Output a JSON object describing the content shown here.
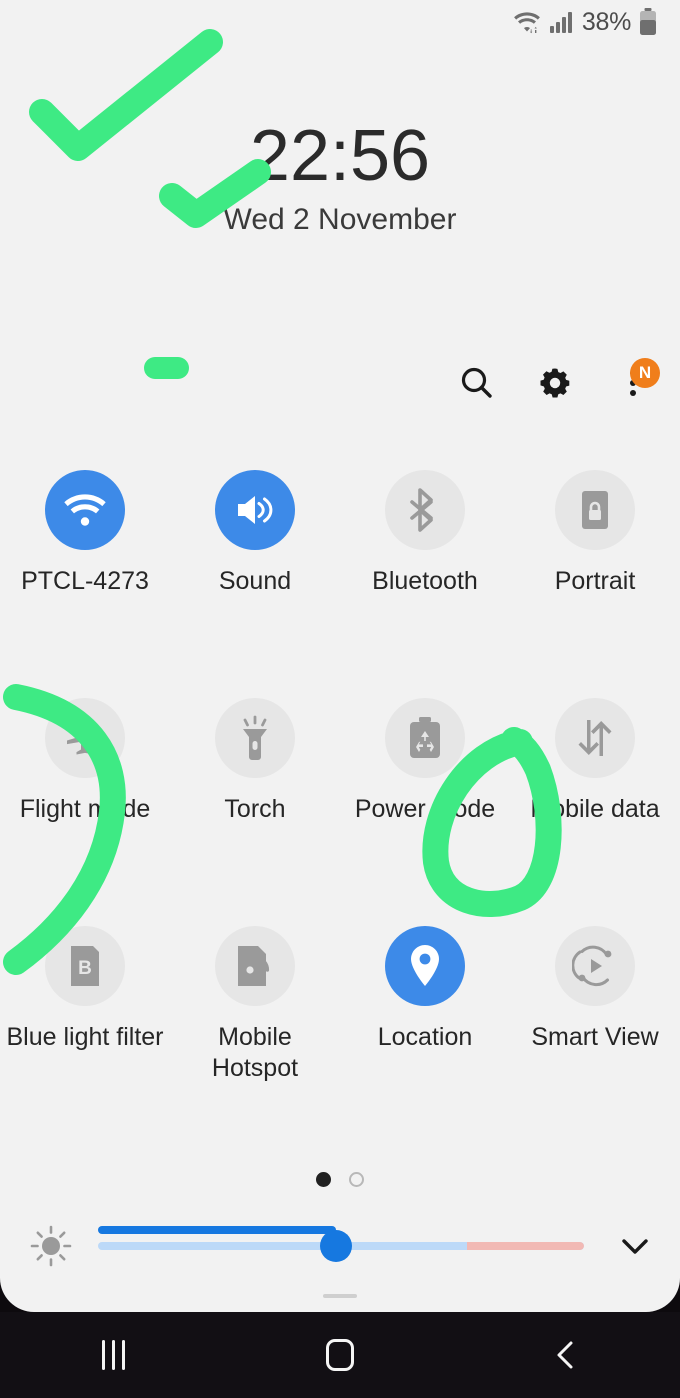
{
  "device": {
    "panel_title": "quick-settings-panel",
    "background_color": "#f2f2f2",
    "accent_on_color": "#3d8ae8",
    "annotation_color": "#3eea84"
  },
  "statusbar": {
    "wifi_icon": "wifi-data-icon",
    "signal_icon": "cellular-signal-icon",
    "battery_percent": "38%",
    "battery_icon": "battery-icon"
  },
  "clock": {
    "time": "22:56",
    "date": "Wed 2 November"
  },
  "header_actions": [
    {
      "name": "search-icon",
      "label": "Search"
    },
    {
      "name": "gear-icon",
      "label": "Settings"
    },
    {
      "name": "more-options-icon",
      "label": "More options",
      "badge": "N"
    }
  ],
  "tiles": [
    {
      "label": "PTCL-4273",
      "icon": "wifi-icon",
      "state": "on"
    },
    {
      "label": "Sound",
      "icon": "sound-icon",
      "state": "on"
    },
    {
      "label": "Bluetooth",
      "icon": "bluetooth-icon",
      "state": "off"
    },
    {
      "label": "Portrait",
      "icon": "rotation-lock-icon",
      "state": "off"
    },
    {
      "label": "Flight mode",
      "icon": "airplane-icon",
      "state": "off"
    },
    {
      "label": "Torch",
      "icon": "flashlight-icon",
      "state": "off"
    },
    {
      "label": "Power mode",
      "icon": "power-mode-icon",
      "state": "off"
    },
    {
      "label": "Mobile data",
      "icon": "mobile-data-icon",
      "state": "off"
    },
    {
      "label": "Blue light filter",
      "icon": "blue-light-filter-icon",
      "state": "off"
    },
    {
      "label": "Mobile Hotspot",
      "icon": "mobile-hotspot-icon",
      "state": "off"
    },
    {
      "label": "Location",
      "icon": "location-pin-icon",
      "state": "on"
    },
    {
      "label": "Smart View",
      "icon": "smart-view-icon",
      "state": "off"
    }
  ],
  "pager": {
    "pages": 2,
    "current_page": 1
  },
  "brightness": {
    "icon": "brightness-sun-icon",
    "value_percent": 49,
    "warning_zone_start_percent": 76,
    "expand_icon": "chevron-down-icon"
  },
  "navbar": [
    {
      "name": "recents-button",
      "icon": "recents-icon"
    },
    {
      "name": "home-button",
      "icon": "home-icon"
    },
    {
      "name": "back-button",
      "icon": "back-chevron-icon"
    }
  ],
  "annotations": [
    {
      "name": "checkmark-large",
      "shape": "check"
    },
    {
      "name": "checkmark-small",
      "shape": "check"
    },
    {
      "name": "dash-mark",
      "shape": "dash"
    },
    {
      "name": "arc-left",
      "shape": "arc"
    },
    {
      "name": "circle-mark",
      "shape": "circle"
    }
  ]
}
